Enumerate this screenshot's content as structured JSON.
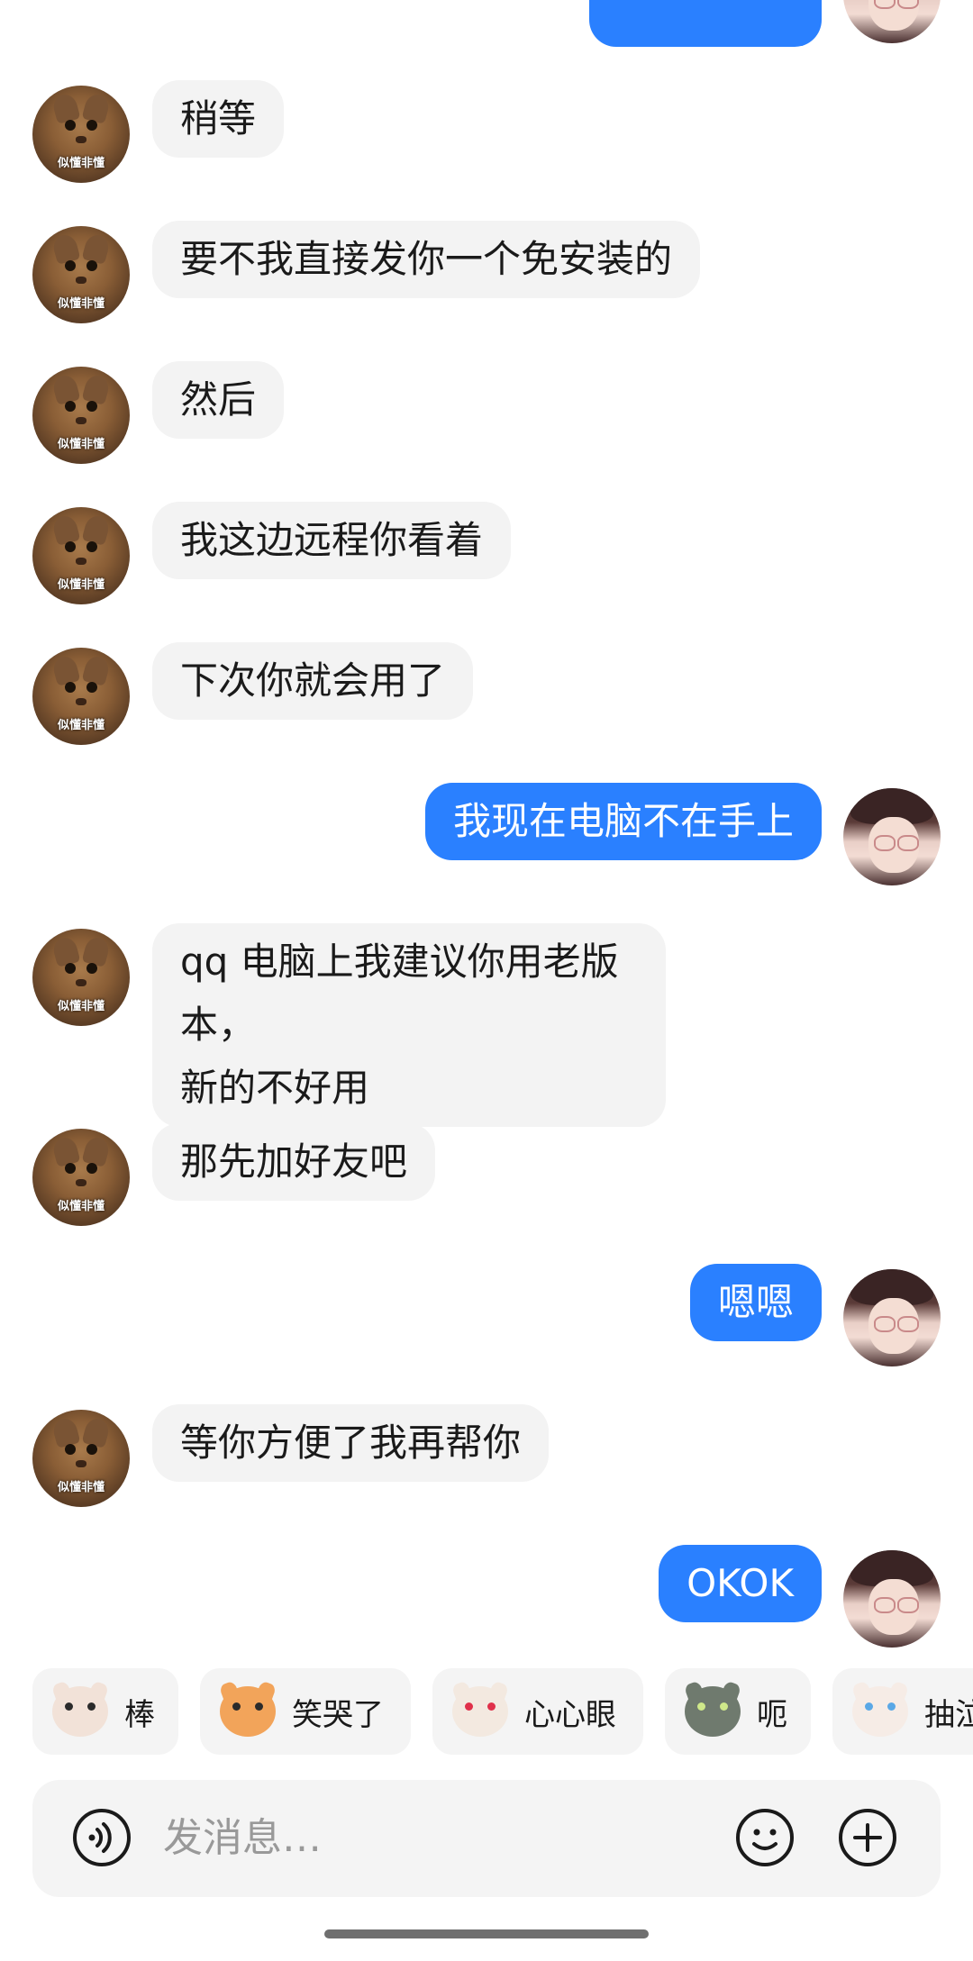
{
  "messages": [
    {
      "side": "out",
      "text": ""
    },
    {
      "side": "in",
      "text": "稍等"
    },
    {
      "side": "in",
      "text": "要不我直接发你一个免安装的"
    },
    {
      "side": "in",
      "text": "然后"
    },
    {
      "side": "in",
      "text": "我这边远程你看着"
    },
    {
      "side": "in",
      "text": "下次你就会用了"
    },
    {
      "side": "out",
      "text": "我现在电脑不在手上"
    },
    {
      "side": "in",
      "lines": [
        "qq 电脑上我建议你用老版本，",
        "新的不好用"
      ]
    },
    {
      "side": "in",
      "text": "那先加好友吧"
    },
    {
      "side": "out",
      "text": "嗯嗯"
    },
    {
      "side": "in",
      "text": "等你方便了我再帮你"
    },
    {
      "side": "out",
      "text": "OKOK"
    }
  ],
  "contact_avatar_caption": "似懂非懂",
  "sticker_suggestions": [
    {
      "label": "棒",
      "icon": "cat-sticker-icon",
      "color": "#f2e2d8"
    },
    {
      "label": "笑哭了",
      "icon": "fox-sticker-icon",
      "color": "#f2a45a"
    },
    {
      "label": "心心眼",
      "icon": "calico-cat-sticker-icon",
      "color": "#f3e9e0"
    },
    {
      "label": "呃",
      "icon": "grey-cat-sticker-icon",
      "color": "#6f7a6e"
    },
    {
      "label": "抽泣",
      "icon": "crying-cat-sticker-icon",
      "color": "#f6ece6"
    }
  ],
  "input": {
    "placeholder": "发消息…"
  },
  "colors": {
    "outgoing_bubble": "#2a80ff",
    "incoming_bubble": "#f3f3f3",
    "background": "#ffffff"
  }
}
